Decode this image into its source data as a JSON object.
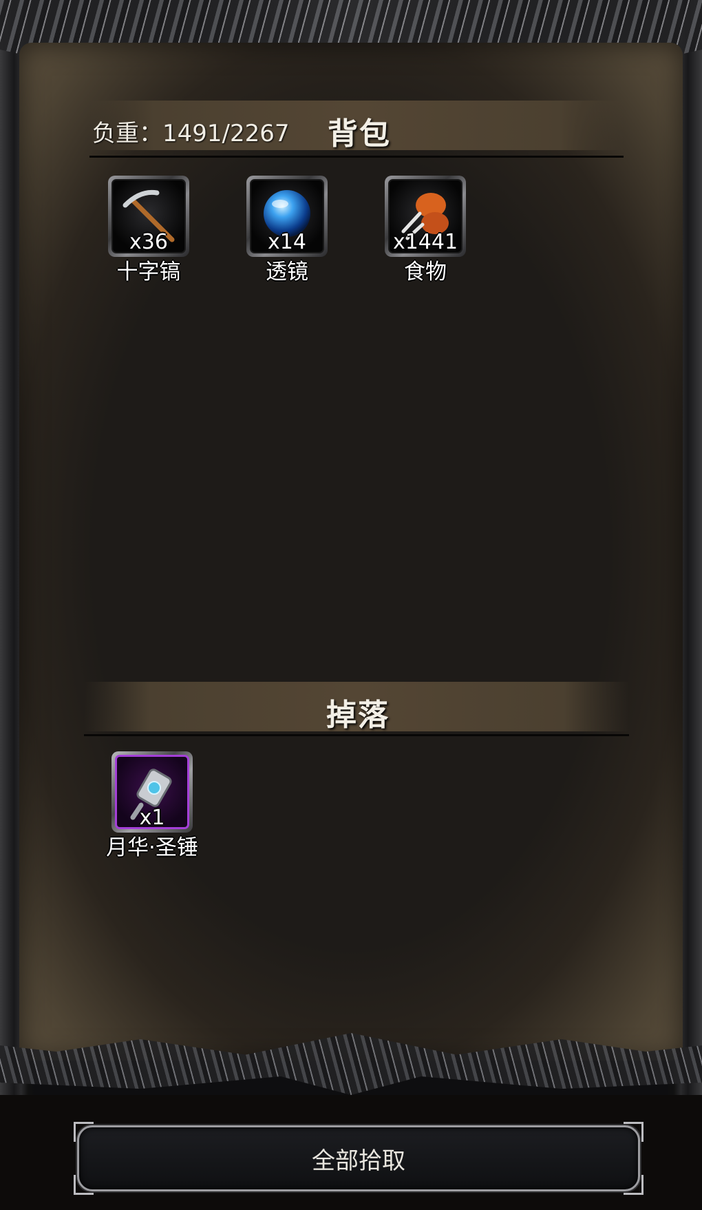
{
  "inventory": {
    "weight_text": "负重：1491/2267",
    "title": "背包",
    "items": [
      {
        "icon": "pickaxe-icon",
        "count": "x36",
        "name": "十字镐"
      },
      {
        "icon": "blue-orb-lens-icon",
        "count": "x14",
        "name": "透镜"
      },
      {
        "icon": "roast-meat-icon",
        "count": "x1441",
        "name": "食物"
      }
    ]
  },
  "drops": {
    "title": "掉落",
    "items": [
      {
        "icon": "hammer-icon",
        "count": "x1",
        "name": "月华·圣锤",
        "rarity_color": "#a43fd8"
      }
    ]
  },
  "actions": {
    "pickup_all_label": "全部拾取"
  }
}
